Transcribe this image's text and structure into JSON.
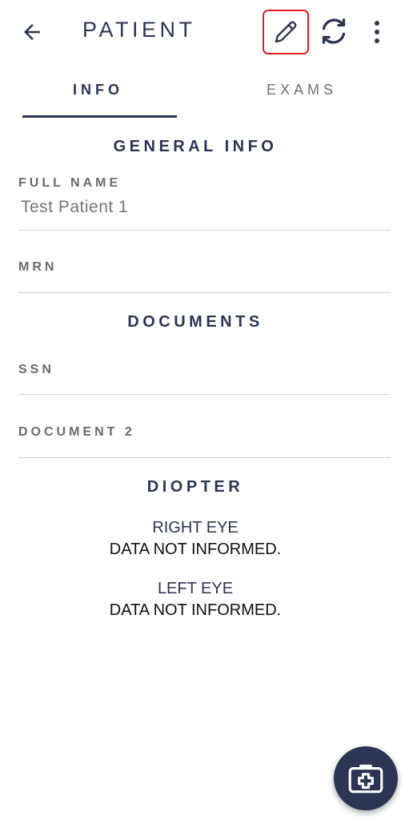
{
  "appbar": {
    "title": "PATIENT",
    "icons": {
      "back": "arrow-back-icon",
      "edit": "pencil-icon",
      "sync": "sync-icon",
      "more": "more-vertical-icon"
    },
    "highlight_color": "#e01b24"
  },
  "tabs": [
    {
      "label": "INFO",
      "selected": true
    },
    {
      "label": "EXAMS",
      "selected": false
    }
  ],
  "general_info": {
    "title": "GENERAL INFO",
    "full_name": {
      "label": "FULL NAME",
      "value": "Test Patient 1"
    },
    "mrn": {
      "label": "MRN",
      "value": ""
    }
  },
  "documents": {
    "title": "DOCUMENTS",
    "ssn": {
      "label": "SSN",
      "value": ""
    },
    "document2": {
      "label": "DOCUMENT 2",
      "value": ""
    }
  },
  "diopter": {
    "title": "DIOPTER",
    "right_eye": {
      "label": "RIGHT EYE",
      "value": "DATA NOT INFORMED."
    },
    "left_eye": {
      "label": "LEFT EYE",
      "value": "DATA NOT INFORMED."
    }
  },
  "fab": {
    "icon": "medical-kit-icon"
  },
  "colors": {
    "primary": "#2c3553",
    "text_muted": "#6b6b6b",
    "divider": "#d2d2d2"
  }
}
